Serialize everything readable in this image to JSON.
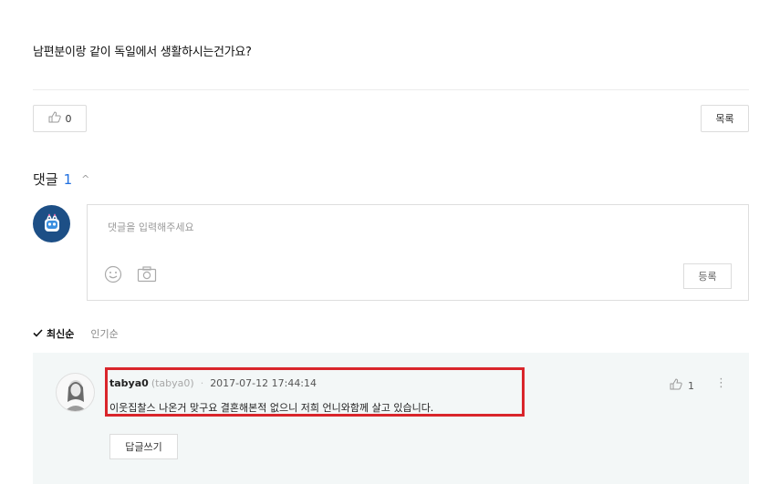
{
  "post": {
    "question": "남편분이랑 같이 독일에서 생활하시는건가요?",
    "like_count": "0",
    "list_label": "목록"
  },
  "comments": {
    "title": "댓글",
    "count": "1",
    "write": {
      "placeholder": "댓글을 입력해주세요",
      "submit_label": "등록"
    },
    "sort": {
      "active": "최신순",
      "inactive": "인기순"
    },
    "items": [
      {
        "nickname": "tabya0",
        "user_id": "(tabya0)",
        "date": "2017-07-12 17:44:14",
        "text": "이웃집찰스 나온거 맞구요 결혼해본적 없으니 저희 언니와함께 살고 있습니다.",
        "likes": "1",
        "reply_label": "답글쓰기"
      }
    ]
  },
  "colors": {
    "accent": "#1f6fe0",
    "highlight": "#d9252b",
    "comment_bg": "#f3f7f7",
    "avatar_bg": "#1d4f86"
  }
}
